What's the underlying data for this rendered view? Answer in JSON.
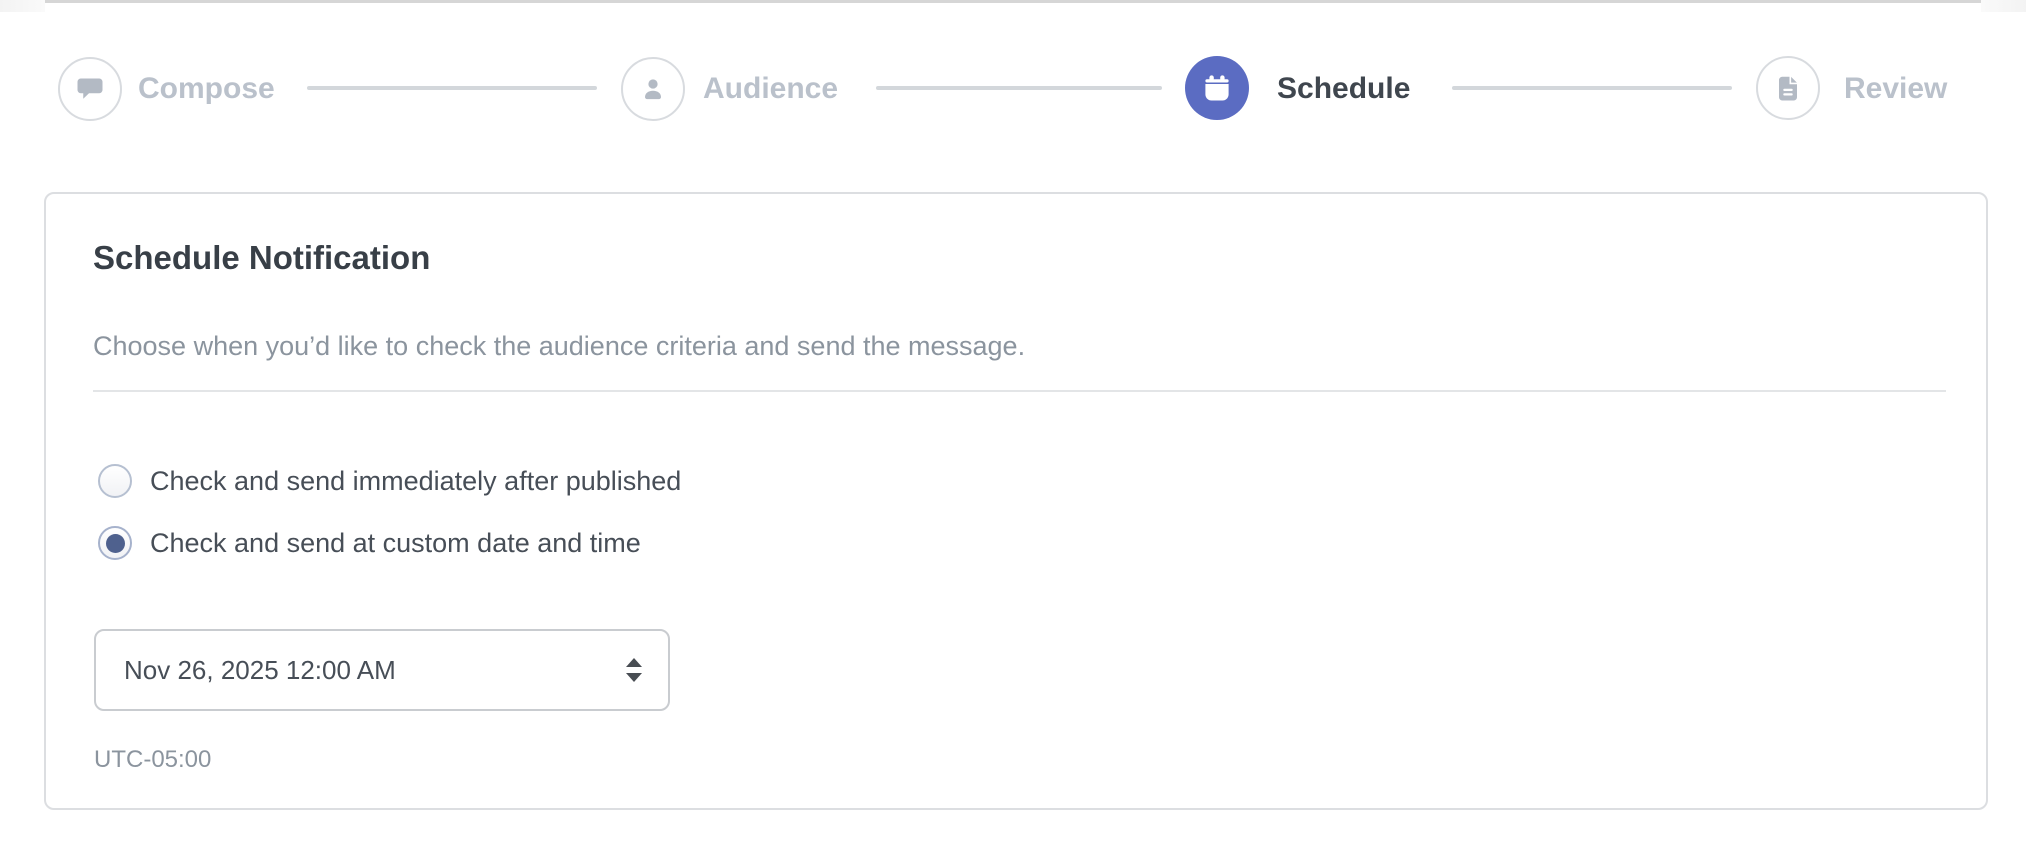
{
  "stepper": {
    "steps": [
      {
        "label": "Compose",
        "icon": "speech-bubble-icon",
        "state": "inactive"
      },
      {
        "label": "Audience",
        "icon": "person-icon",
        "state": "inactive"
      },
      {
        "label": "Schedule",
        "icon": "calendar-icon",
        "state": "active"
      },
      {
        "label": "Review",
        "icon": "document-icon",
        "state": "inactive"
      }
    ]
  },
  "card": {
    "title": "Schedule Notification",
    "description": "Choose when you’d like to check the audience criteria and send the message.",
    "options": [
      {
        "label": "Check and send immediately after published",
        "selected": false
      },
      {
        "label": "Check and send at custom date and time",
        "selected": true
      }
    ],
    "datetime": {
      "value": "Nov 26, 2025 12:00 AM"
    },
    "timezone": "UTC-05:00"
  },
  "colors": {
    "accent": "#5b6cc2",
    "inactive_step": "#bac1cb",
    "active_label": "#3f464e",
    "radio_dot": "#4f618e"
  }
}
